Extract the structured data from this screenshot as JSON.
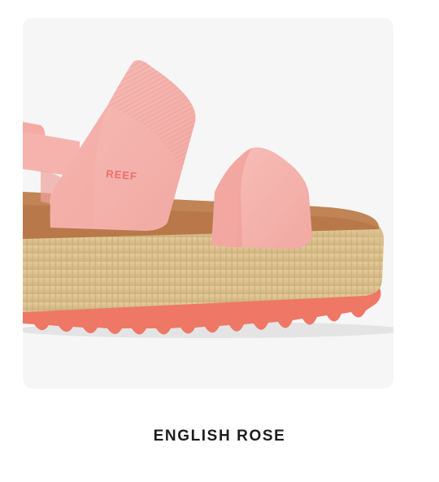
{
  "product": {
    "color_name": "ENGLISH ROSE",
    "brand_mark": "REEF",
    "image_alt": "Pink platform sandal with tan ridged midsole and coral lug outsole"
  },
  "colors": {
    "card_background": "#f6f6f6",
    "strap": "#f6b3ae",
    "footbed": "#b8784a",
    "midsole": "#dcc291",
    "outsole": "#ee7766",
    "brand_text": "#ee6f6c"
  }
}
